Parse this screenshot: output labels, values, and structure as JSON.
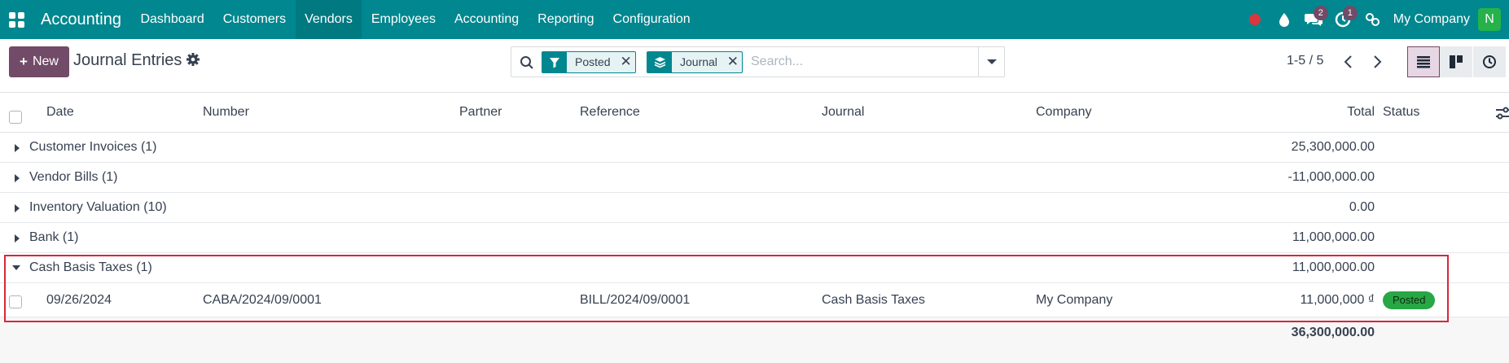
{
  "navbar": {
    "brand": "Accounting",
    "items": [
      {
        "label": "Dashboard",
        "active": false
      },
      {
        "label": "Customers",
        "active": false
      },
      {
        "label": "Vendors",
        "active": true
      },
      {
        "label": "Employees",
        "active": false
      },
      {
        "label": "Accounting",
        "active": false
      },
      {
        "label": "Reporting",
        "active": false
      },
      {
        "label": "Configuration",
        "active": false
      }
    ],
    "chat_badge": "2",
    "activity_badge": "1",
    "company": "My Company",
    "avatar_initial": "N"
  },
  "control": {
    "new_label": "New",
    "title": "Journal Entries",
    "facets": [
      {
        "icon": "filter-icon",
        "label": "Posted"
      },
      {
        "icon": "group-by-icon",
        "label": "Journal"
      }
    ],
    "search_placeholder": "Search...",
    "pager": "1-5 / 5"
  },
  "list": {
    "columns": {
      "date": "Date",
      "number": "Number",
      "partner": "Partner",
      "reference": "Reference",
      "journal": "Journal",
      "company": "Company",
      "total": "Total",
      "status": "Status"
    },
    "groups": [
      {
        "name": "Customer Invoices (1)",
        "total": "25,300,000.00",
        "expanded": false
      },
      {
        "name": "Vendor Bills (1)",
        "total": "-11,000,000.00",
        "expanded": false
      },
      {
        "name": "Inventory Valuation (10)",
        "total": "0.00",
        "expanded": false
      },
      {
        "name": "Bank (1)",
        "total": "11,000,000.00",
        "expanded": false
      },
      {
        "name": "Cash Basis Taxes (1)",
        "total": "11,000,000.00",
        "expanded": true
      }
    ],
    "record": {
      "date": "09/26/2024",
      "number": "CABA/2024/09/0001",
      "partner": "",
      "reference": "BILL/2024/09/0001",
      "journal": "Cash Basis Taxes",
      "company": "My Company",
      "total": "11,000,000 ₫",
      "status": "Posted"
    },
    "grand_total": "36,300,000.00"
  },
  "colors": {
    "navbar": "#00878f",
    "primary": "#714b67",
    "highlight_border": "#d6273b",
    "posted_badge": "#28a745"
  }
}
